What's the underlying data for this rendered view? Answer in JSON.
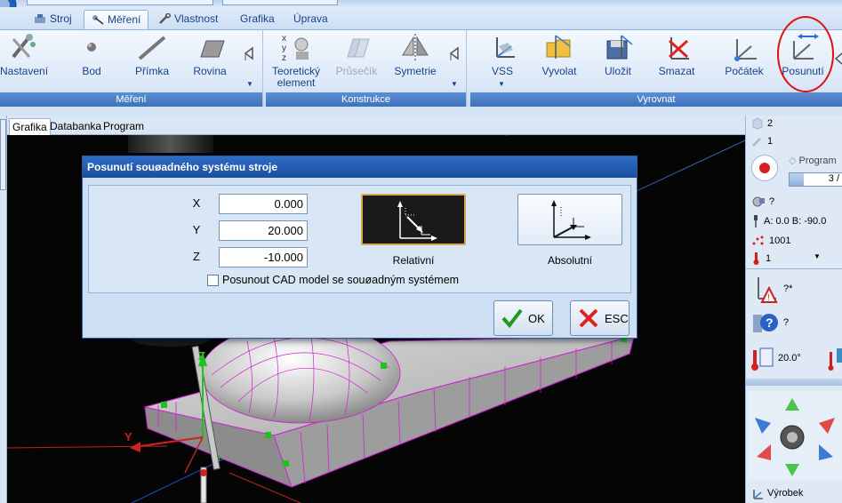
{
  "tabs": [
    {
      "label": "Stroj"
    },
    {
      "label": "Měření",
      "active": true
    },
    {
      "label": "Vlastnost"
    },
    {
      "label": "Grafika"
    },
    {
      "label": "Úprava"
    }
  ],
  "ribbon": {
    "mereni": {
      "group_label": "Měření",
      "buttons": [
        "Nastavení",
        "Bod",
        "Přímka",
        "Rovina"
      ]
    },
    "konstrukce": {
      "group_label": "Konstrukce",
      "buttons": [
        "Teoretický",
        "element",
        "Průsečík",
        "Symetrie"
      ]
    },
    "vyrovnat": {
      "group_label": "Vyrovnat",
      "buttons": [
        "VSS",
        "Vyvolat",
        "Uložit",
        "Smazat",
        "Počátek",
        "Posunutí"
      ]
    }
  },
  "doc_tabs": [
    "Grafika",
    "Databanka",
    "Program"
  ],
  "right_panel": {
    "count_2": "2",
    "count_1": "1",
    "program_label": "Program",
    "program_progress": "3 /",
    "probe_value": "?",
    "angles": "A: 0.0  B: -90.0",
    "stylus_id": "1001",
    "temp_sel": "1",
    "warning_value": "?*",
    "help_value": "?",
    "temperature": "20.0°",
    "vyrobek_label": "Výrobek"
  },
  "dialog": {
    "title": "Posunutí souøadného systému stroje",
    "x_label": "X",
    "y_label": "Y",
    "z_label": "Z",
    "x_value": "0.000",
    "y_value": "20.000",
    "z_value": "-10.000",
    "relative_label": "Relativní",
    "absolute_label": "Absolutní",
    "checkbox_label": "Posunout CAD model se souøadným systémem",
    "checkbox_checked": false,
    "ok_label": "OK",
    "esc_label": "ESC"
  },
  "viewport": {
    "axis_y": "Y",
    "axis_z": "Z"
  },
  "colors": {
    "ribbon_label_bg": "#3f72bd",
    "dialog_title_bg": "#1b4f9e",
    "highlight_circle": "#e01010",
    "model_mesh": "#d020d0"
  }
}
